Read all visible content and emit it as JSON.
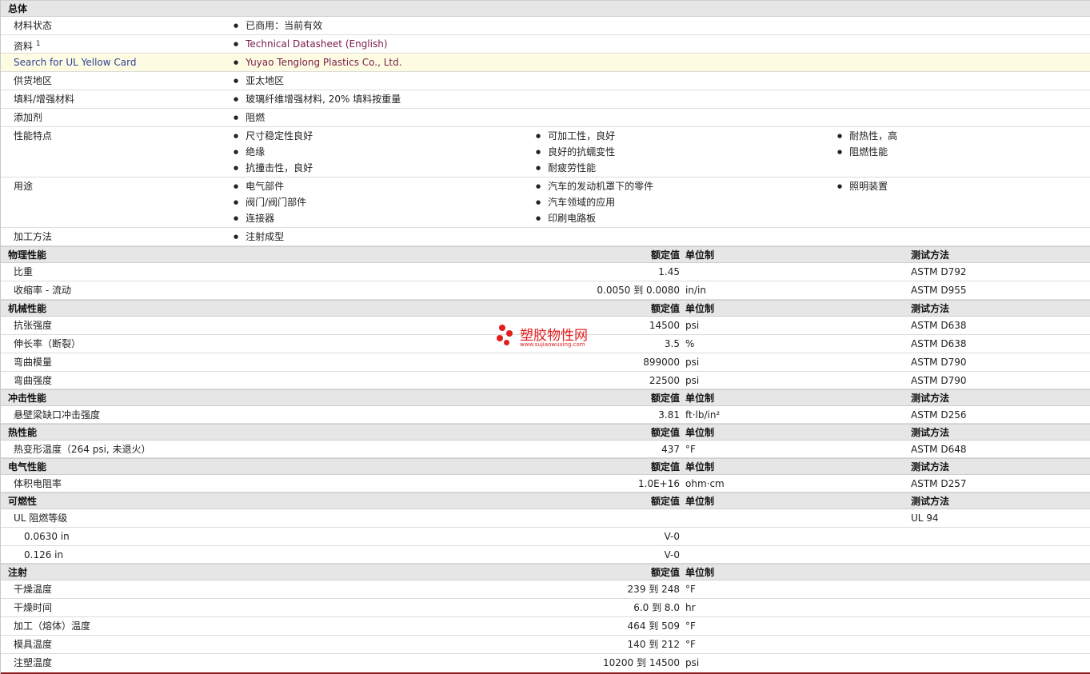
{
  "sections": {
    "general": {
      "title": "总体",
      "rows": {
        "status": {
          "label": "材料状态",
          "values": [
            "已商用：当前有效"
          ]
        },
        "docs": {
          "label": "资料",
          "sup": "1",
          "values": [
            "Technical Datasheet (English)"
          ]
        },
        "ul": {
          "label": "Search for UL Yellow Card",
          "values": [
            "Yuyao Tenglong Plastics Co., Ltd."
          ]
        },
        "region": {
          "label": "供货地区",
          "values": [
            "亚太地区"
          ]
        },
        "filler": {
          "label": "填料/增强材料",
          "values": [
            "玻璃纤维增强材料, 20% 填料按重量"
          ]
        },
        "additive": {
          "label": "添加剂",
          "values": [
            "阻燃"
          ]
        },
        "features": {
          "label": "性能特点",
          "col1": [
            "尺寸稳定性良好",
            "绝缘",
            "抗撞击性，良好"
          ],
          "col2": [
            "可加工性，良好",
            "良好的抗蠕变性",
            "耐疲劳性能"
          ],
          "col3": [
            "耐热性，高",
            "阻燃性能"
          ]
        },
        "uses": {
          "label": "用途",
          "col1": [
            "电气部件",
            "阀门/阀门部件",
            "连接器"
          ],
          "col2": [
            "汽车的发动机罩下的零件",
            "汽车领域的应用",
            "印刷电路板"
          ],
          "col3": [
            "照明装置"
          ]
        },
        "process": {
          "label": "加工方法",
          "values": [
            "注射成型"
          ]
        }
      }
    },
    "headers": {
      "nominal": "额定值",
      "unit": "单位制",
      "method": "测试方法"
    },
    "physical": {
      "title": "物理性能",
      "rows": [
        {
          "label": "比重",
          "value": "1.45",
          "unit": "",
          "method": "ASTM D792"
        },
        {
          "label": "收缩率 - 流动",
          "value": "0.0050 到  0.0080",
          "unit": "in/in",
          "method": "ASTM D955"
        }
      ]
    },
    "mechanical": {
      "title": "机械性能",
      "rows": [
        {
          "label": "抗张强度",
          "value": "14500",
          "unit": "psi",
          "method": "ASTM D638"
        },
        {
          "label": "伸长率（断裂）",
          "value": "3.5",
          "unit": "%",
          "method": "ASTM D638"
        },
        {
          "label": "弯曲模量",
          "value": "899000",
          "unit": "psi",
          "method": "ASTM D790"
        },
        {
          "label": "弯曲强度",
          "value": "22500",
          "unit": "psi",
          "method": "ASTM D790"
        }
      ]
    },
    "impact": {
      "title": "冲击性能",
      "rows": [
        {
          "label": "悬壁梁缺口冲击强度",
          "value": "3.81",
          "unit": "ft·lb/in²",
          "method": "ASTM D256"
        }
      ]
    },
    "thermal": {
      "title": "热性能",
      "rows": [
        {
          "label": "热变形温度（264 psi, 未退火）",
          "value": "437",
          "unit": "°F",
          "method": "ASTM D648"
        }
      ]
    },
    "electrical": {
      "title": "电气性能",
      "rows": [
        {
          "label": "体积电阻率",
          "value": "1.0E+16",
          "unit": "ohm·cm",
          "method": "ASTM D257"
        }
      ]
    },
    "flammability": {
      "title": "可燃性",
      "rows": [
        {
          "label": "UL 阻燃等级",
          "value": "",
          "unit": "",
          "method": "UL 94"
        },
        {
          "label": "0.0630 in",
          "value": "V-0",
          "unit": "",
          "method": ""
        },
        {
          "label": "0.126 in",
          "value": "V-0",
          "unit": "",
          "method": ""
        }
      ]
    },
    "injection": {
      "title": "注射",
      "rows": [
        {
          "label": "干燥温度",
          "value": "239 到  248",
          "unit": "°F",
          "method": ""
        },
        {
          "label": "干燥时间",
          "value": "6.0 到  8.0",
          "unit": "hr",
          "method": ""
        },
        {
          "label": "加工（熔体）温度",
          "value": "464 到  509",
          "unit": "°F",
          "method": ""
        },
        {
          "label": "模具温度",
          "value": "140 到  212",
          "unit": "°F",
          "method": ""
        },
        {
          "label": "注塑温度",
          "value": "10200 到  14500",
          "unit": "psi",
          "method": ""
        }
      ]
    }
  },
  "watermark": {
    "name": "塑胶物性网",
    "url": "www.sujiaowuxing.com"
  },
  "colors": {
    "header_bg": "#e6e6e6",
    "highlight_bg": "#fdfce2",
    "link": "#7a1c48",
    "watermark": "#e11d1d"
  }
}
